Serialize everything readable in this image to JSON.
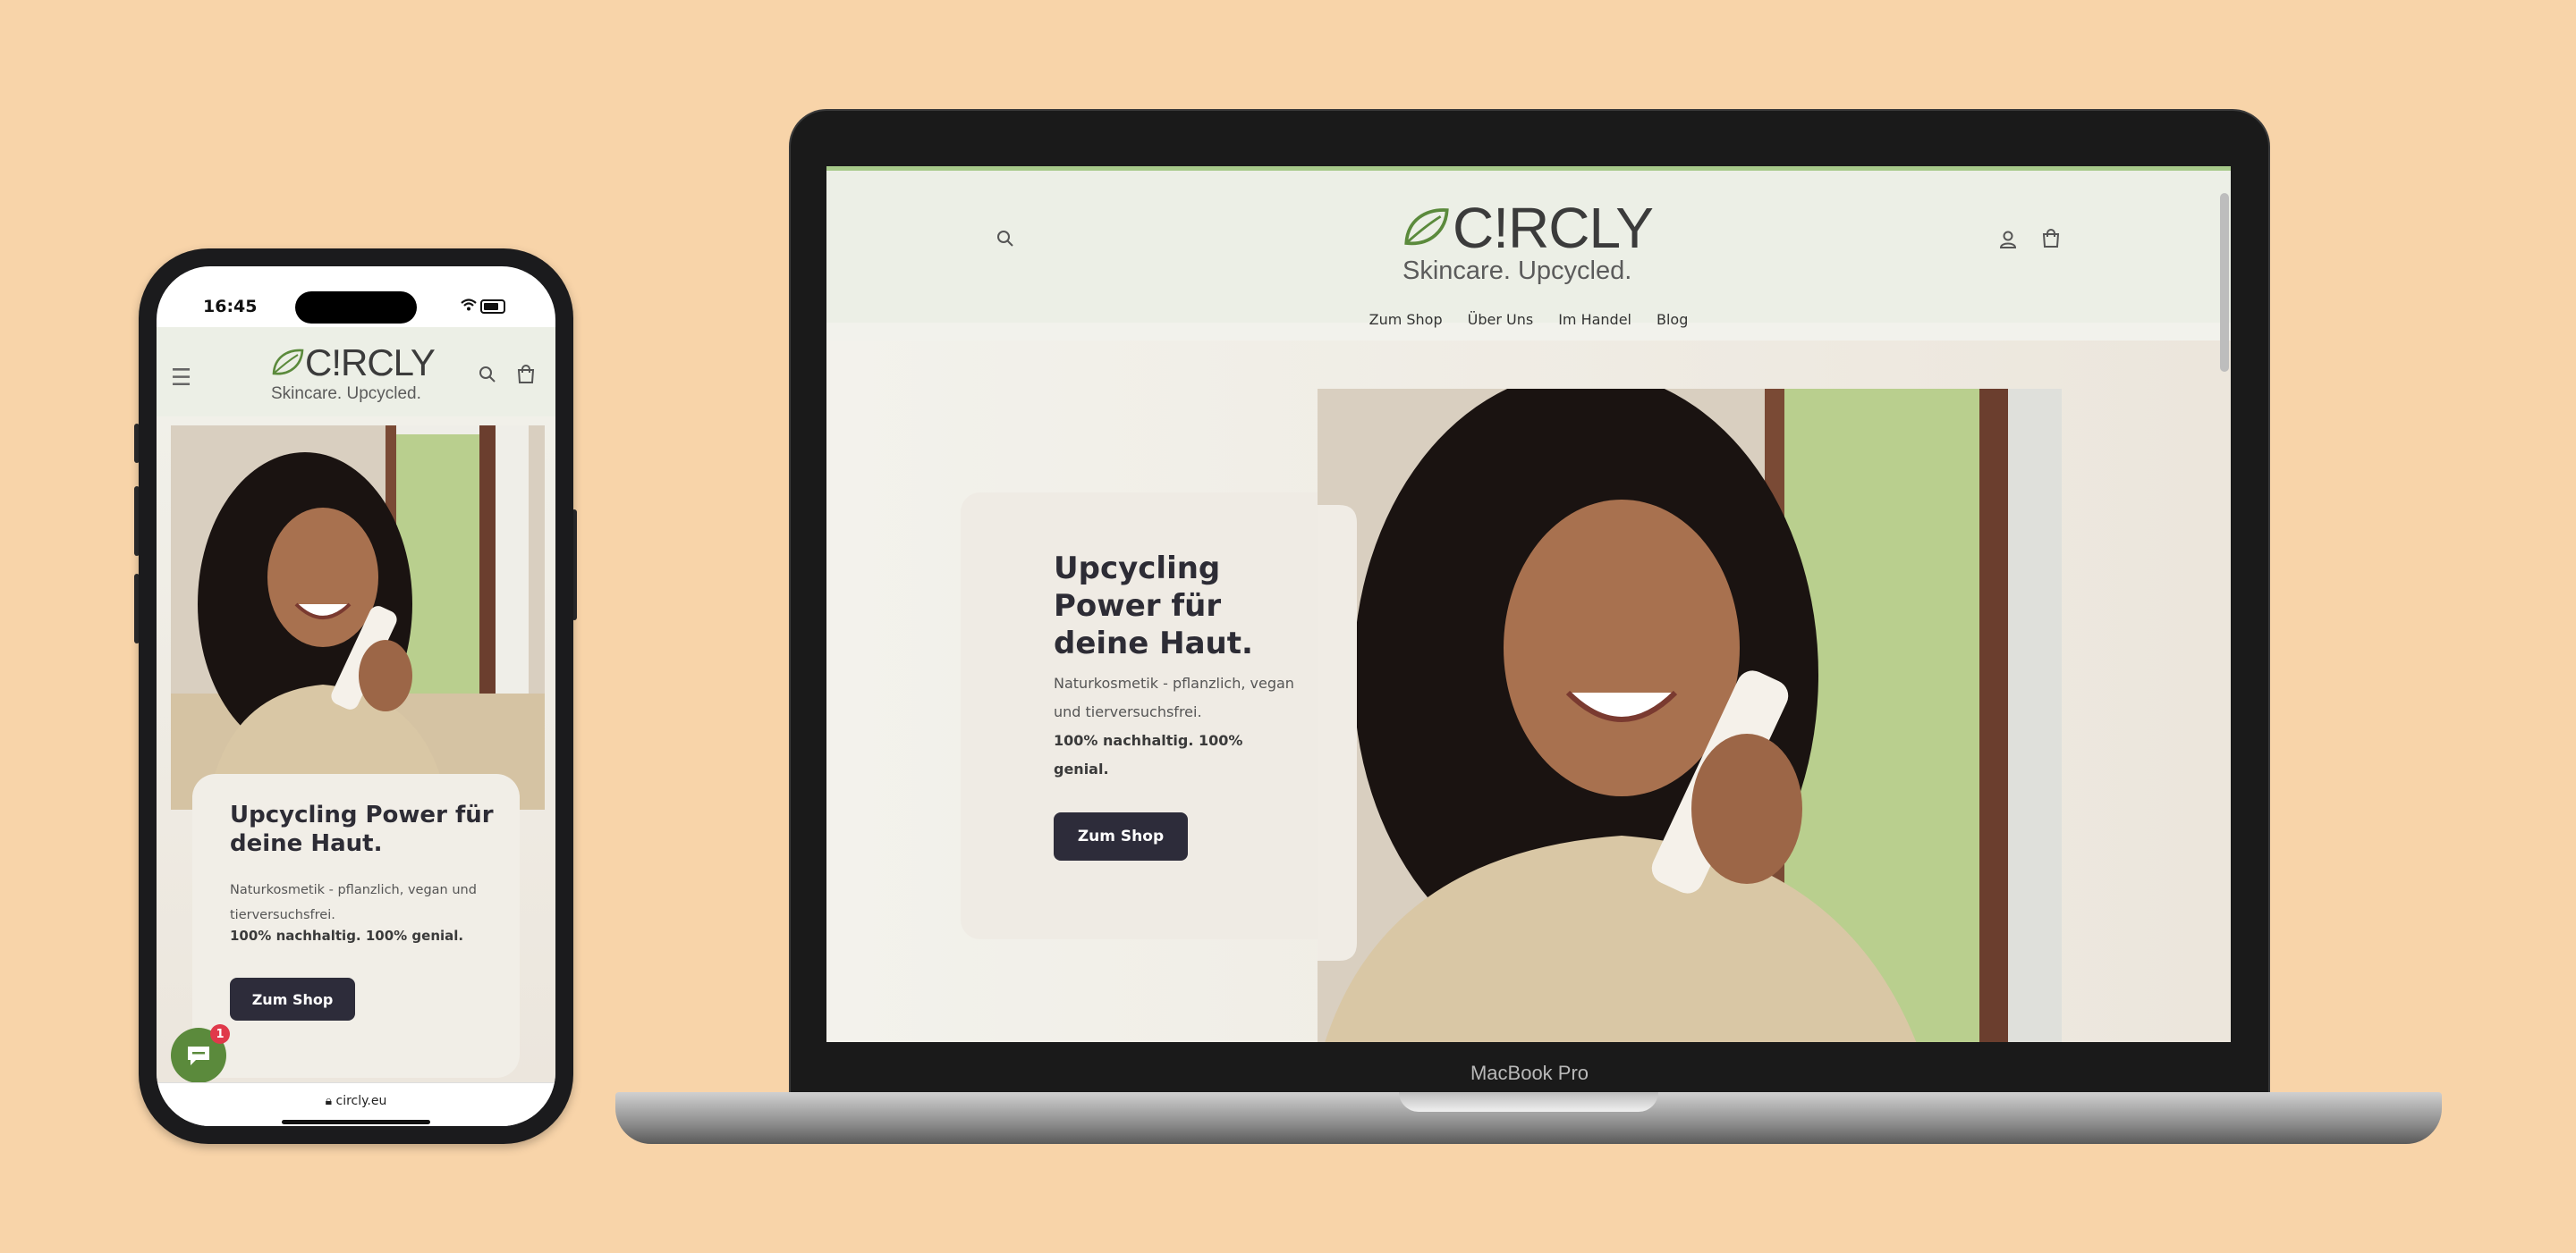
{
  "phone": {
    "status_time": "16:45",
    "brand": "C!RCLY",
    "tagline": "Skincare. Upcycled.",
    "hero_title": "Upcycling Power für deine Haut.",
    "hero_desc": "Naturkosmetik - pflanzlich, vegan und tierversuchsfrei.",
    "hero_desc_bold": "100% nachhaltig. 100% genial.",
    "cta_label": "Zum Shop",
    "chat_badge": "1",
    "url": "circly.eu",
    "icons": [
      "menu-icon",
      "leaf-logo-icon",
      "search-icon",
      "cart-icon",
      "chat-icon",
      "lock-icon",
      "wifi-icon",
      "battery-icon"
    ]
  },
  "laptop": {
    "model_label": "MacBook Pro",
    "brand": "C!RCLY",
    "tagline": "Skincare. Upcycled.",
    "nav": [
      "Zum Shop",
      "Über Uns",
      "Im Handel",
      "Blog"
    ],
    "hero_title": "Upcycling Power für deine Haut.",
    "hero_desc": "Naturkosmetik - pflanzlich, vegan und tierversuchsfrei.",
    "hero_desc_bold": "100% nachhaltig. 100% genial.",
    "cta_label": "Zum Shop",
    "icons": [
      "search-icon",
      "leaf-logo-icon",
      "account-icon",
      "cart-icon"
    ]
  },
  "colors": {
    "background": "#f8d4a9",
    "header": "#ecefe6",
    "button": "#2d2c3a",
    "accent_green": "#5b8a3c",
    "badge": "#e0394b"
  }
}
